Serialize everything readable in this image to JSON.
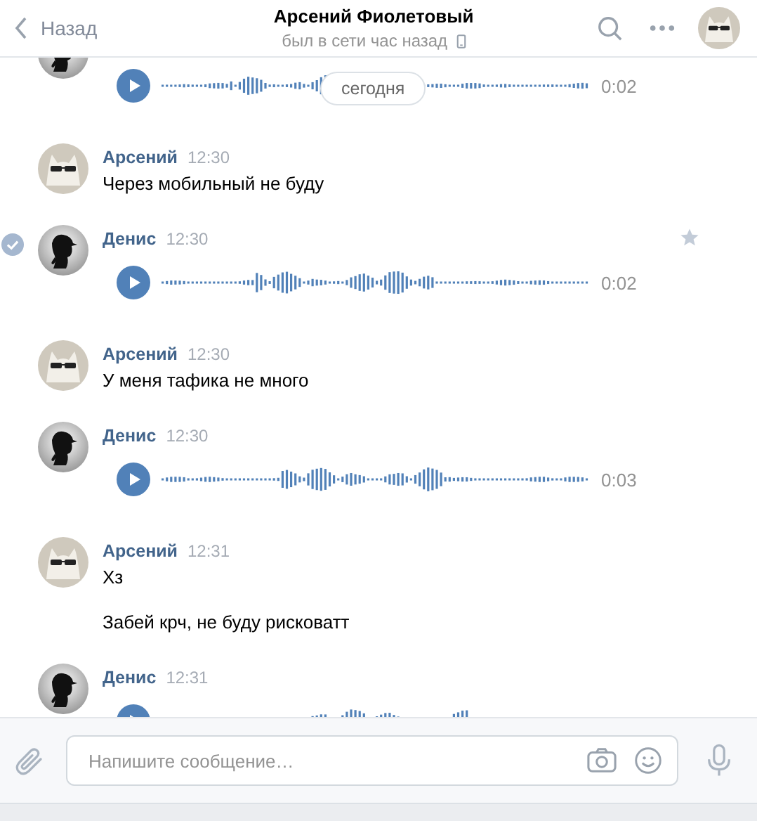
{
  "header": {
    "back": "Назад",
    "title": "Арсений Фиолетовый",
    "status": "был в сети час назад"
  },
  "date_badge": "сегодня",
  "messages": [
    {
      "avatar": {
        "kind": "silhouette"
      },
      "selected": false,
      "items": [
        {
          "kind": "voice",
          "duration": "0:02"
        }
      ]
    },
    {
      "avatar": {
        "kind": "cat"
      },
      "author": "Арсений",
      "time": "12:30",
      "selected": false,
      "items": [
        {
          "kind": "text",
          "text": "Через мобильный не буду"
        }
      ]
    },
    {
      "avatar": {
        "kind": "silhouette"
      },
      "author": "Денис",
      "time": "12:30",
      "selected": true,
      "items": [
        {
          "kind": "voice",
          "duration": "0:02"
        }
      ]
    },
    {
      "avatar": {
        "kind": "cat"
      },
      "author": "Арсений",
      "time": "12:30",
      "selected": false,
      "items": [
        {
          "kind": "text",
          "text": "У меня тафика не много"
        }
      ]
    },
    {
      "avatar": {
        "kind": "silhouette"
      },
      "author": "Денис",
      "time": "12:30",
      "selected": false,
      "items": [
        {
          "kind": "voice",
          "duration": "0:03"
        }
      ]
    },
    {
      "avatar": {
        "kind": "cat"
      },
      "author": "Арсений",
      "time": "12:31",
      "selected": false,
      "items": [
        {
          "kind": "text",
          "text": "Хз"
        },
        {
          "kind": "text",
          "text": "Забей крч, не буду рисковатт"
        }
      ]
    },
    {
      "avatar": {
        "kind": "silhouette"
      },
      "author": "Денис",
      "time": "12:31",
      "selected": false,
      "items": [
        {
          "kind": "voice"
        }
      ]
    }
  ],
  "composer": {
    "placeholder": "Напишите сообщение…"
  }
}
